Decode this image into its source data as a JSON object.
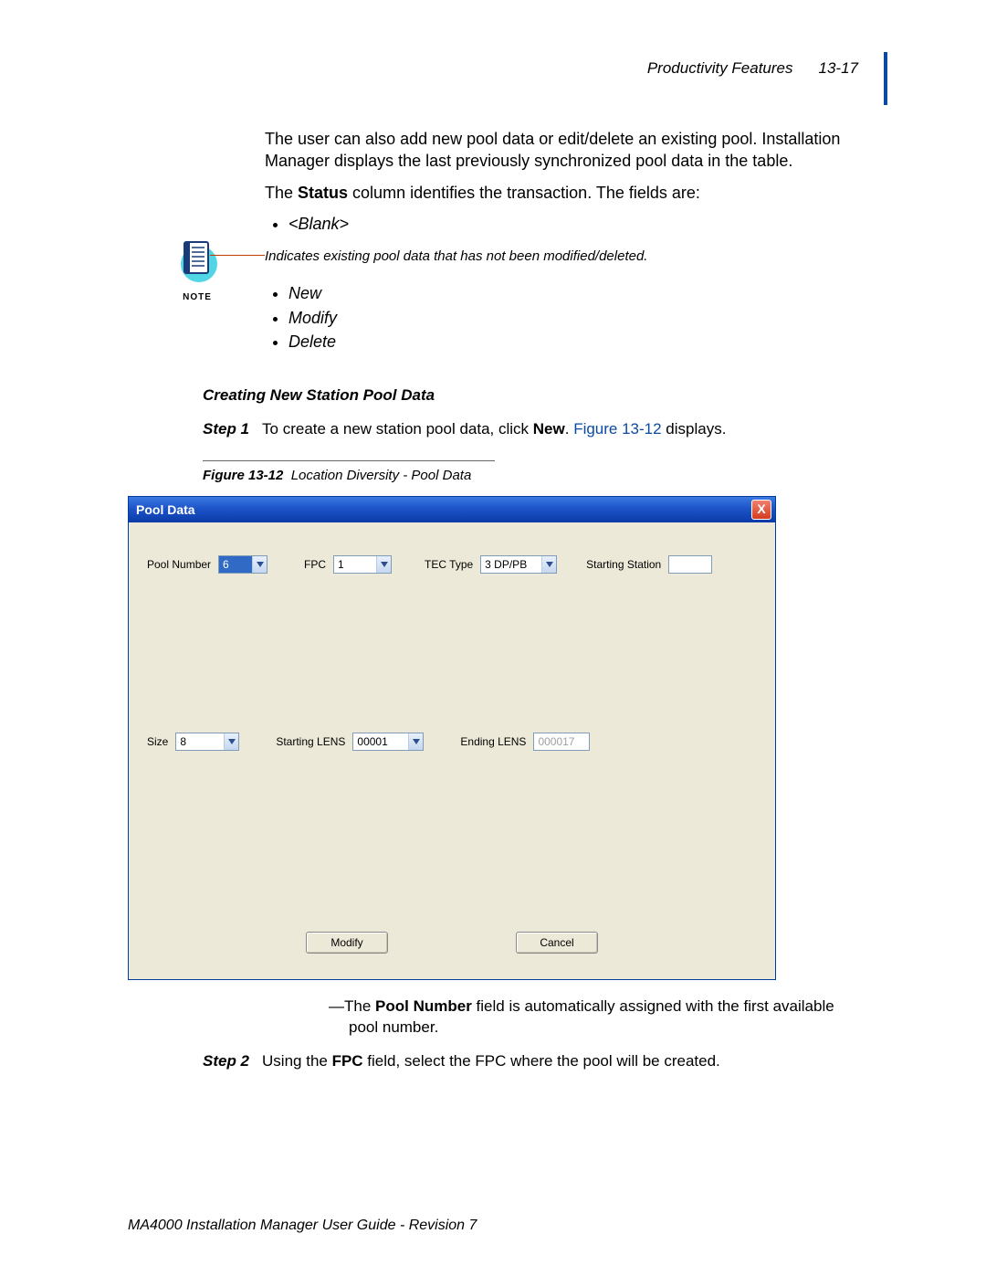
{
  "header": {
    "section": "Productivity Features",
    "pageNumber": "13-17"
  },
  "intro": {
    "p1": "The user can also add new pool data or edit/delete an existing pool. Installation Manager displays the last previously synchronized pool data in the table.",
    "p2_pre": "The ",
    "p2_bold": "Status",
    "p2_post": " column identifies the transaction. The fields are:"
  },
  "statusBullets": {
    "blank": "<Blank>",
    "new": "New",
    "modify": "Modify",
    "delete": "Delete"
  },
  "note": {
    "label": "NOTE",
    "text": "Indicates existing pool data that has not been modified/deleted."
  },
  "section": {
    "heading": "Creating New Station Pool Data"
  },
  "steps": {
    "s1": {
      "label": "Step 1",
      "pre": "To create a new station pool data, click ",
      "bold": "New",
      "post": ". ",
      "link": "Figure 13-12",
      "post2": " displays."
    },
    "s2": {
      "label": "Step 2",
      "pre": "Using the ",
      "bold": "FPC",
      "post": " field, select the FPC where the pool will be created."
    }
  },
  "figure": {
    "number": "Figure 13-12",
    "title": "Location Diversity - Pool Data"
  },
  "dialog": {
    "title": "Pool Data",
    "closeGlyph": "X",
    "fields": {
      "poolNumber": {
        "label": "Pool Number",
        "value": "6"
      },
      "fpc": {
        "label": "FPC",
        "value": "1"
      },
      "tecType": {
        "label": "TEC Type",
        "value": "3 DP/PB"
      },
      "startingStation": {
        "label": "Starting Station",
        "value": ""
      },
      "size": {
        "label": "Size",
        "value": "8"
      },
      "startingLens": {
        "label": "Starting LENS",
        "value": "00001"
      },
      "endingLens": {
        "label": "Ending LENS",
        "value": "000017"
      }
    },
    "buttons": {
      "modify": "Modify",
      "cancel": "Cancel"
    }
  },
  "afterDialog": {
    "bullet_pre": "—The ",
    "bullet_bold": "Pool Number",
    "bullet_post": " field is automatically assigned with the first available pool number."
  },
  "footer": "MA4000 Installation Manager User Guide - Revision 7"
}
